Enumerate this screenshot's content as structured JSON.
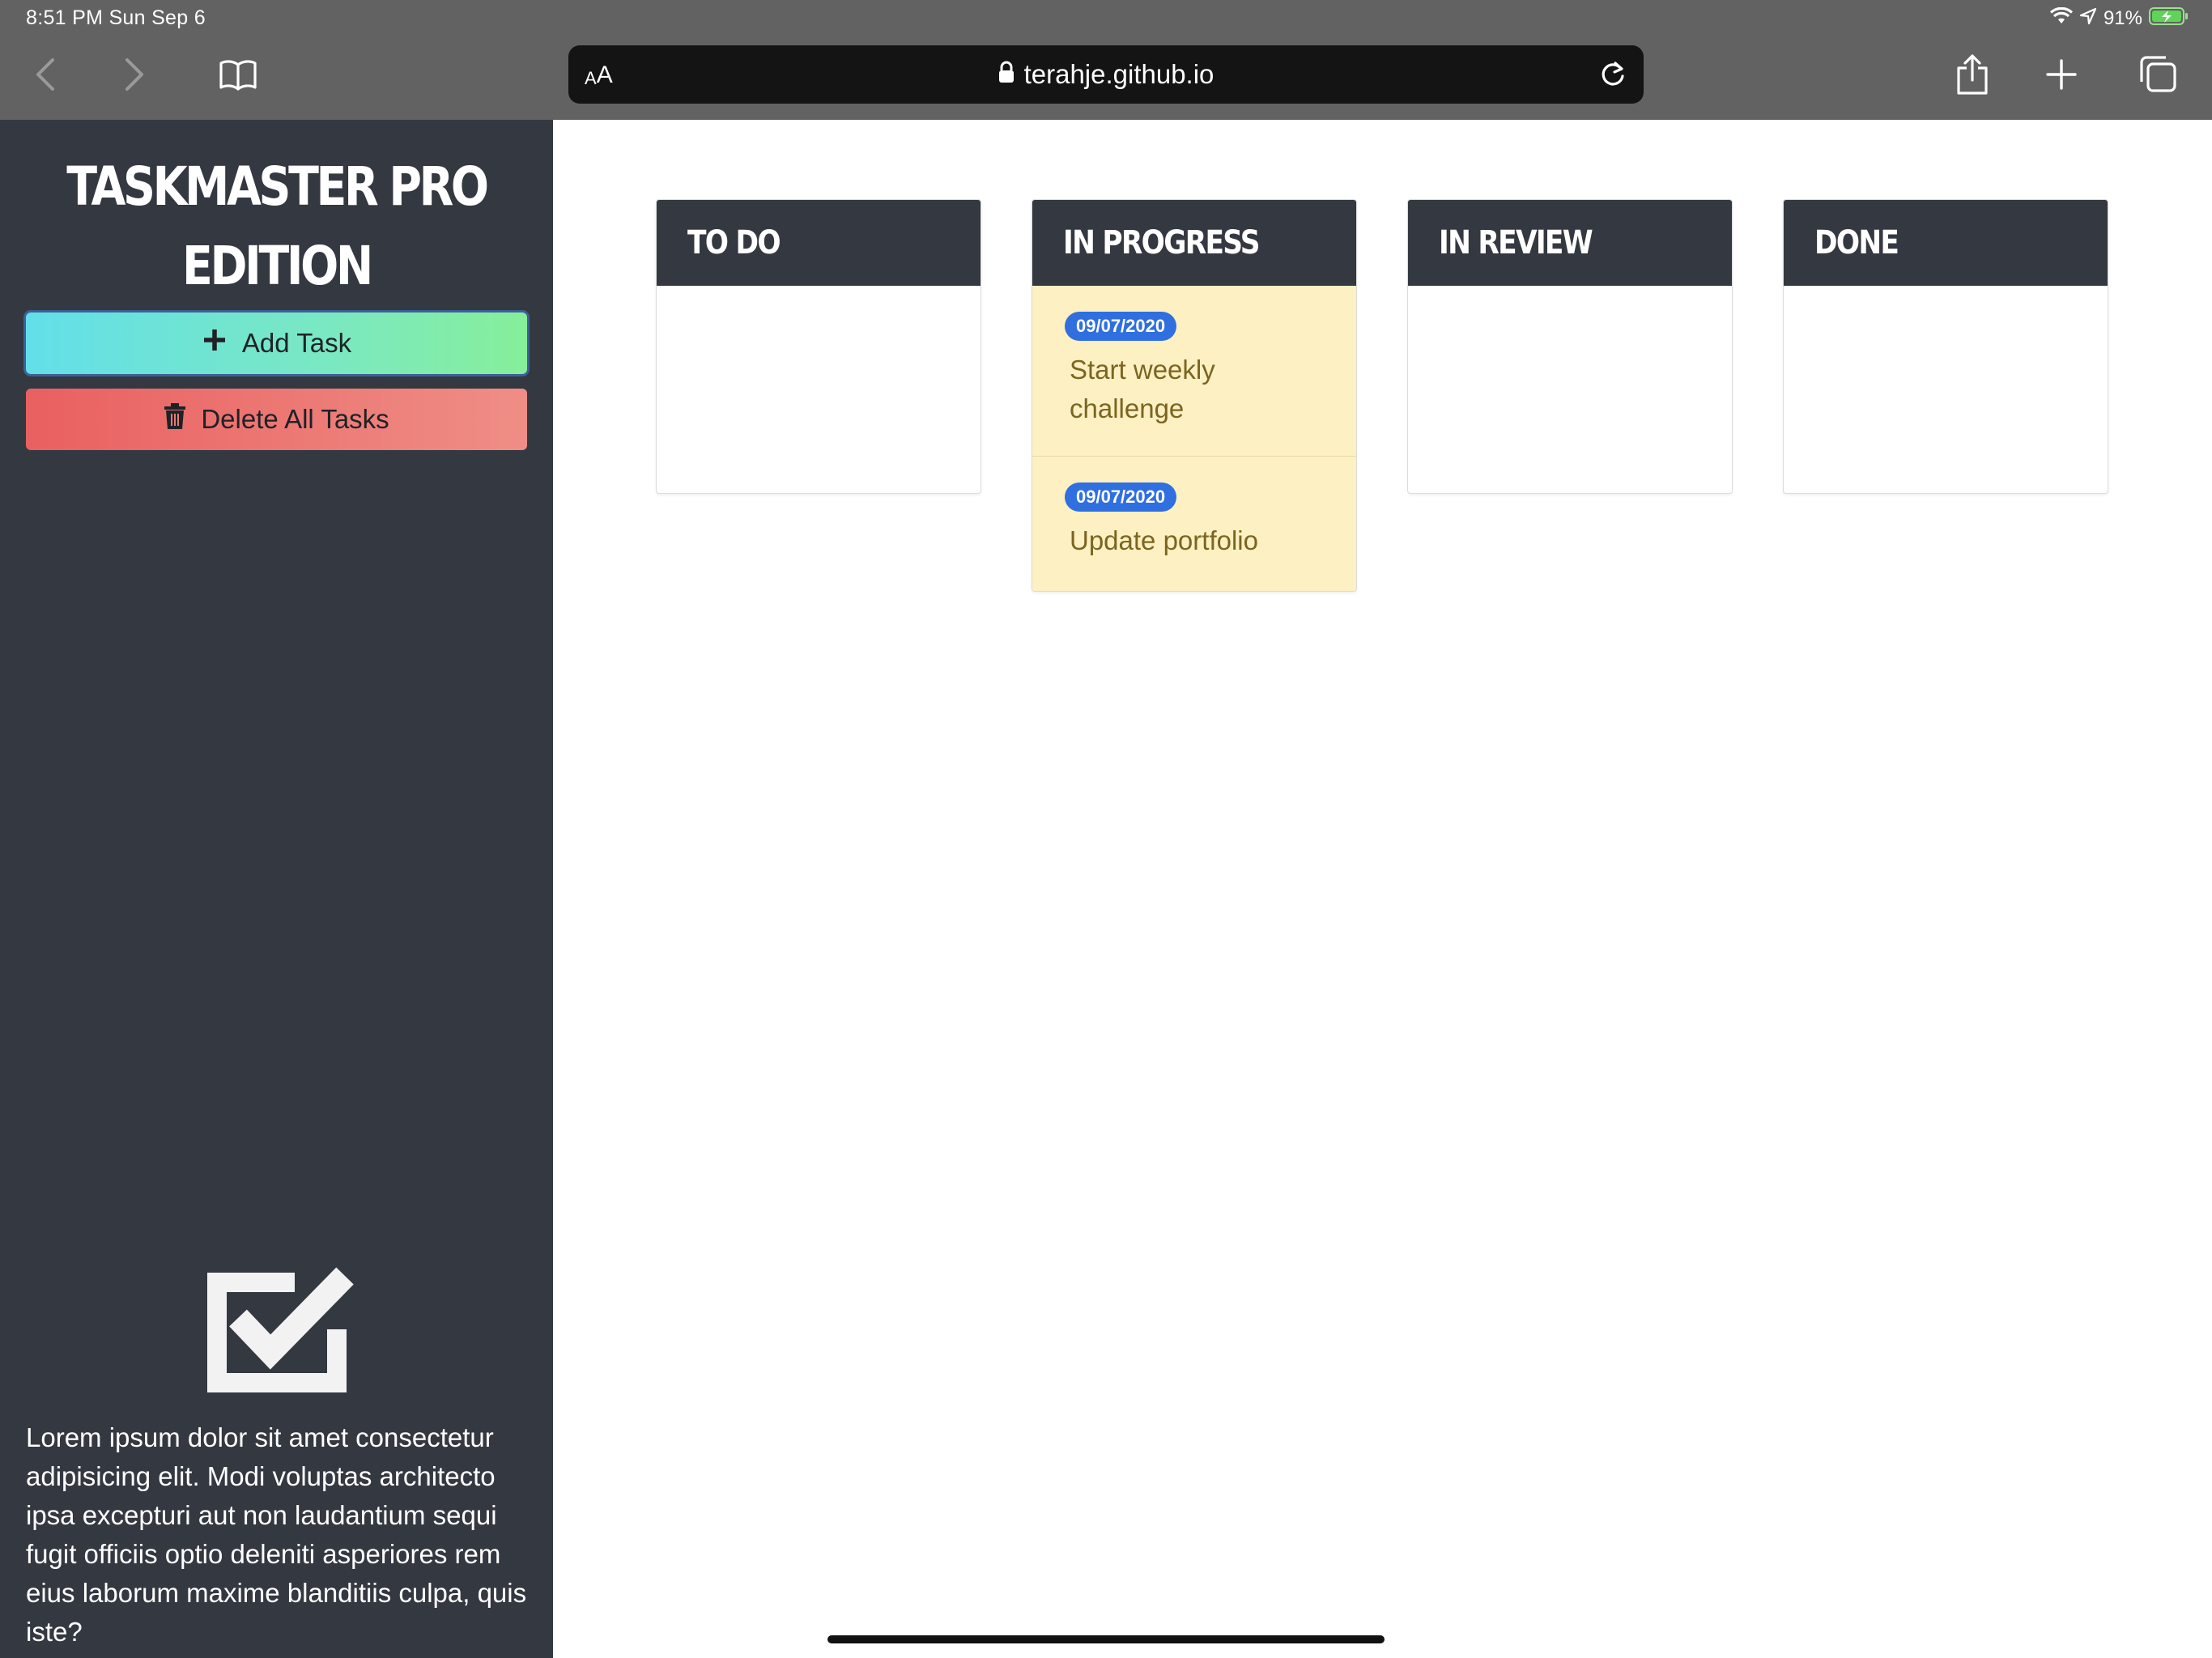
{
  "status_bar": {
    "time": "8:51 PM  Sun Sep 6",
    "battery": "91%"
  },
  "browser": {
    "text_size_small": "A",
    "text_size_big": "A",
    "url": "terahje.github.io"
  },
  "sidebar": {
    "title": "TASKMASTER PRO\nEDITION",
    "add_task_label": "Add Task",
    "delete_all_label": "Delete All Tasks",
    "description": "Lorem ipsum dolor sit amet consectetur adipisicing elit. Modi voluptas architecto ipsa excepturi aut non laudantium sequi fugit officiis optio deleniti asperiores rem eius laborum maxime blanditiis culpa, quis iste?"
  },
  "board": {
    "columns": [
      {
        "title": "TO DO",
        "tasks": []
      },
      {
        "title": "IN PROGRESS",
        "tasks": [
          {
            "date": "09/07/2020",
            "title": "Start weekly challenge"
          },
          {
            "date": "09/07/2020",
            "title": "Update portfolio"
          }
        ]
      },
      {
        "title": "IN REVIEW",
        "tasks": []
      },
      {
        "title": "DONE",
        "tasks": []
      }
    ]
  },
  "colors": {
    "sidebar_bg": "#343841",
    "browser_chrome": "#626262",
    "add_gradient": [
      "#62dfe9",
      "#86ef9a"
    ],
    "delete_gradient": [
      "#e96060",
      "#ef8e86"
    ],
    "task_card_bg": "#fdf0c2",
    "date_badge": "#2f6fe0"
  },
  "icons": [
    "back-icon",
    "forward-icon",
    "book-icon",
    "lock-icon",
    "reload-icon",
    "share-icon",
    "plus-icon",
    "tabs-icon",
    "wifi-icon",
    "location-icon",
    "battery-icon",
    "trash-icon",
    "checkbox-icon"
  ]
}
